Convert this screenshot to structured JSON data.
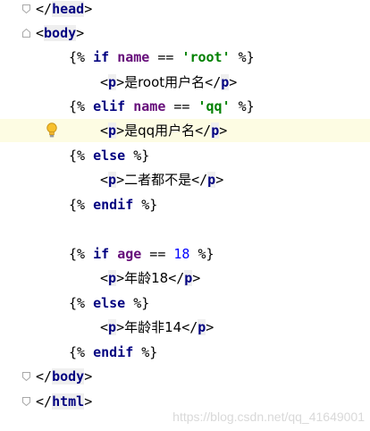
{
  "editor": {
    "lines": [
      {
        "id": "close-head",
        "parts": [
          [
            "</",
            "tag-bracket"
          ],
          [
            "head",
            "tag-name"
          ],
          [
            ">",
            "tag-bracket"
          ]
        ]
      },
      {
        "id": "open-body",
        "parts": [
          [
            "<",
            "tag-bracket"
          ],
          [
            "body",
            "tag-name"
          ],
          [
            ">",
            "tag-bracket"
          ]
        ]
      },
      {
        "id": "if-name-root",
        "parts": [
          [
            "{% ",
            "jinja-delim"
          ],
          [
            "if",
            "kw"
          ],
          [
            " ",
            "op"
          ],
          [
            "name",
            "ident"
          ],
          [
            " == ",
            "op"
          ],
          [
            "'root'",
            "str"
          ],
          [
            " %}",
            "jinja-delim"
          ]
        ]
      },
      {
        "id": "p-root",
        "parts": [
          [
            "<",
            "tag-bracket"
          ],
          [
            "p",
            "tag-name"
          ],
          [
            ">",
            "tag-bracket"
          ],
          [
            "是root用户名",
            "text"
          ],
          [
            "</",
            "tag-bracket"
          ],
          [
            "p",
            "tag-name"
          ],
          [
            ">",
            "tag-bracket"
          ]
        ]
      },
      {
        "id": "elif-name-qq",
        "parts": [
          [
            "{% ",
            "jinja-delim"
          ],
          [
            "elif",
            "kw"
          ],
          [
            " ",
            "op"
          ],
          [
            "name",
            "ident"
          ],
          [
            " == ",
            "op"
          ],
          [
            "'qq'",
            "str"
          ],
          [
            " %}",
            "jinja-delim"
          ]
        ]
      },
      {
        "id": "p-qq",
        "parts": [
          [
            "<",
            "tag-bracket"
          ],
          [
            "p",
            "tag-name"
          ],
          [
            ">",
            "tag-bracket"
          ],
          [
            "是qq用户名",
            "text"
          ],
          [
            "</",
            "tag-bracket"
          ],
          [
            "p",
            "tag-name"
          ],
          [
            ">",
            "tag-bracket"
          ]
        ]
      },
      {
        "id": "else-1",
        "parts": [
          [
            "{% ",
            "jinja-delim"
          ],
          [
            "else",
            "kw"
          ],
          [
            " %}",
            "jinja-delim"
          ]
        ]
      },
      {
        "id": "p-neither",
        "parts": [
          [
            "<",
            "tag-bracket"
          ],
          [
            "p",
            "tag-name"
          ],
          [
            ">",
            "tag-bracket"
          ],
          [
            "二者都不是",
            "text"
          ],
          [
            "</",
            "tag-bracket"
          ],
          [
            "p",
            "tag-name"
          ],
          [
            ">",
            "tag-bracket"
          ]
        ]
      },
      {
        "id": "endif-1",
        "parts": [
          [
            "{% ",
            "jinja-delim"
          ],
          [
            "endif",
            "kw"
          ],
          [
            " %}",
            "jinja-delim"
          ]
        ]
      },
      {
        "id": "blank",
        "parts": []
      },
      {
        "id": "if-age-18",
        "parts": [
          [
            "{% ",
            "jinja-delim"
          ],
          [
            "if",
            "kw"
          ],
          [
            " ",
            "op"
          ],
          [
            "age",
            "ident"
          ],
          [
            " == ",
            "op"
          ],
          [
            "18",
            "num"
          ],
          [
            " %}",
            "jinja-delim"
          ]
        ]
      },
      {
        "id": "p-age-18",
        "parts": [
          [
            "<",
            "tag-bracket"
          ],
          [
            "p",
            "tag-name"
          ],
          [
            ">",
            "tag-bracket"
          ],
          [
            "年龄18",
            "text"
          ],
          [
            "</",
            "tag-bracket"
          ],
          [
            "p",
            "tag-name"
          ],
          [
            ">",
            "tag-bracket"
          ]
        ]
      },
      {
        "id": "else-2",
        "parts": [
          [
            "{% ",
            "jinja-delim"
          ],
          [
            "else",
            "kw"
          ],
          [
            " %}",
            "jinja-delim"
          ]
        ]
      },
      {
        "id": "p-age-not-14",
        "parts": [
          [
            "<",
            "tag-bracket"
          ],
          [
            "p",
            "tag-name"
          ],
          [
            ">",
            "tag-bracket"
          ],
          [
            "年龄非14",
            "text"
          ],
          [
            "</",
            "tag-bracket"
          ],
          [
            "p",
            "tag-name"
          ],
          [
            ">",
            "tag-bracket"
          ]
        ]
      },
      {
        "id": "endif-2",
        "parts": [
          [
            "{% ",
            "jinja-delim"
          ],
          [
            "endif",
            "kw"
          ],
          [
            " %}",
            "jinja-delim"
          ]
        ]
      },
      {
        "id": "close-body",
        "parts": [
          [
            "</",
            "tag-bracket"
          ],
          [
            "body",
            "tag-name"
          ],
          [
            ">",
            "tag-bracket"
          ]
        ]
      },
      {
        "id": "close-html",
        "parts": [
          [
            "</",
            "tag-bracket"
          ],
          [
            "html",
            "tag-name"
          ],
          [
            ">",
            "tag-bracket"
          ]
        ]
      }
    ]
  },
  "intention_icon": "lightbulb-icon",
  "watermark": "https://blog.csdn.net/qq_41649001"
}
